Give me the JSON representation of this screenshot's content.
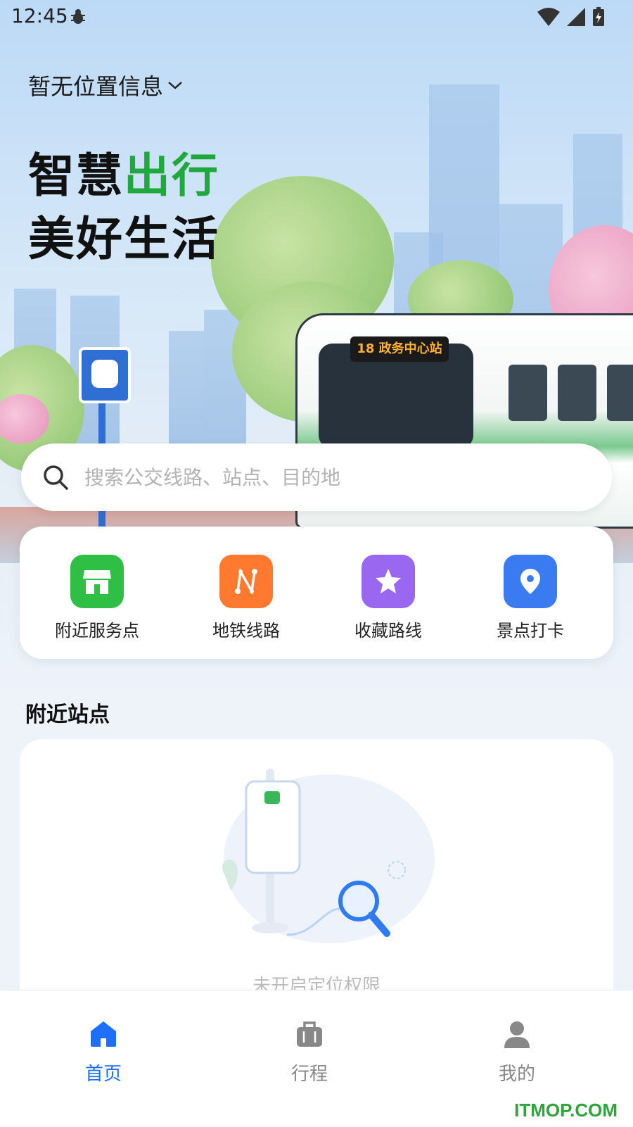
{
  "status_bar": {
    "time": "12:45"
  },
  "location": {
    "label": "暂无位置信息"
  },
  "slogan": {
    "line1_black": "智慧",
    "line1_green": "出行",
    "line2": "美好生活"
  },
  "bus": {
    "sign": "18 政务中心站"
  },
  "search": {
    "placeholder": "搜索公交线路、站点、目的地"
  },
  "quick_actions": [
    {
      "label": "附近服务点",
      "color": "#2fbf45",
      "icon": "store-icon"
    },
    {
      "label": "地铁线路",
      "color": "#ff7a2e",
      "icon": "route-icon"
    },
    {
      "label": "收藏路线",
      "color": "#9a68f0",
      "icon": "star-icon"
    },
    {
      "label": "景点打卡",
      "color": "#3a7bf2",
      "icon": "location-pin-icon"
    }
  ],
  "nearby": {
    "title": "附近站点",
    "empty_text": "未开启定位权限"
  },
  "tabs": [
    {
      "label": "首页",
      "icon": "home-icon",
      "active": true
    },
    {
      "label": "行程",
      "icon": "luggage-icon",
      "active": false
    },
    {
      "label": "我的",
      "icon": "profile-icon",
      "active": false
    }
  ],
  "colors": {
    "accent": "#1f6fff",
    "green": "#1fa83b",
    "inactive": "#888888"
  },
  "watermark": "ITMOP.COM"
}
